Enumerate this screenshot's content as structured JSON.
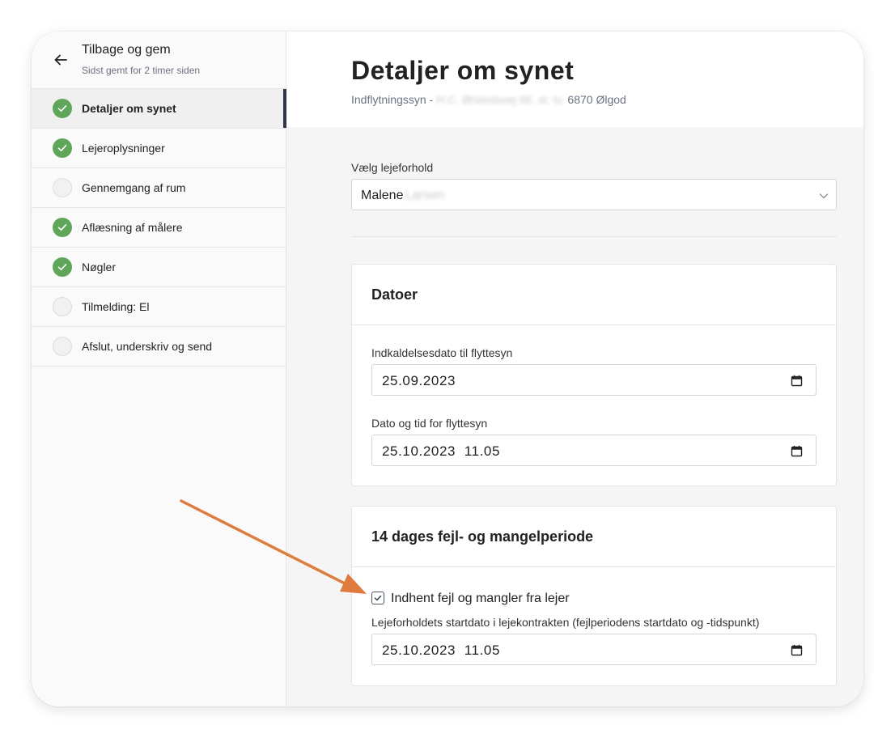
{
  "sidebar": {
    "back_title": "Tilbage og gem",
    "saved_status": "Sidst gemt for 2 timer siden",
    "steps": [
      {
        "label": "Detaljer om synet",
        "status": "done",
        "active": true
      },
      {
        "label": "Lejeroplysninger",
        "status": "done",
        "active": false
      },
      {
        "label": "Gennemgang af rum",
        "status": "todo",
        "active": false
      },
      {
        "label": "Aflæsning af målere",
        "status": "done",
        "active": false
      },
      {
        "label": "Nøgler",
        "status": "done",
        "active": false
      },
      {
        "label": "Tilmelding: El",
        "status": "todo",
        "active": false
      },
      {
        "label": "Afslut, underskriv og send",
        "status": "todo",
        "active": false
      }
    ]
  },
  "main": {
    "title": "Detaljer om synet",
    "subtitle_prefix": "Indflytningssyn - ",
    "subtitle_blurred": "H.C. Ørstedsvej 66, st. tv.",
    "subtitle_suffix": " 6870 Ølgod",
    "tenancy": {
      "label": "Vælg lejeforhold",
      "value_first": "Malene",
      "value_blurred": "Larsen"
    },
    "dates_card": {
      "title": "Datoer",
      "summons_label": "Indkaldelsesdato til flyttesyn",
      "summons_value": "25.09.2023",
      "inspection_label": "Dato og tid for flyttesyn",
      "inspection_value": "25.10.2023  11.05"
    },
    "defects_card": {
      "title": "14 dages fejl- og mangelperiode",
      "checkbox_label": "Indhent fejl og mangler fra lejer",
      "checkbox_checked": true,
      "start_label": "Lejeforholdets startdato i lejekontrakten (fejlperiodens startdato og -tidspunkt)",
      "start_value": "25.10.2023  11.05"
    }
  },
  "colors": {
    "done": "#5fa55a",
    "active_indicator": "#2d3748",
    "annotation_arrow": "#e07b3f"
  }
}
